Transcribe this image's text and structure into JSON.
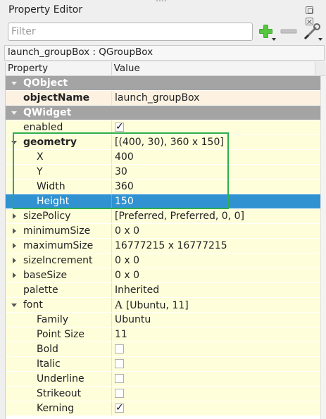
{
  "window": {
    "title": "Property Editor"
  },
  "toolbar": {
    "filter_placeholder": "Filter",
    "add_icon": "green-plus-icon",
    "remove_icon": "minus-icon",
    "config_icon": "wrench-icon"
  },
  "class_label": "launch_groupBox : QGroupBox",
  "columns": {
    "property": "Property",
    "value": "Value"
  },
  "rows": [
    {
      "prop": "QObject",
      "value": "",
      "kind": "group"
    },
    {
      "prop": "objectName",
      "value": "launch_groupBox",
      "kind": "cream",
      "bold": true
    },
    {
      "prop": "QWidget",
      "value": "",
      "kind": "group"
    },
    {
      "prop": "enabled",
      "value": "",
      "kind": "yellow",
      "check": true
    },
    {
      "prop": "geometry",
      "value": "[(400, 30), 360 x 150]",
      "kind": "yellow",
      "bold": true,
      "expand": "down"
    },
    {
      "prop": "X",
      "value": "400",
      "kind": "yellow",
      "depth": 1
    },
    {
      "prop": "Y",
      "value": "30",
      "kind": "yellow",
      "depth": 1
    },
    {
      "prop": "Width",
      "value": "360",
      "kind": "yellow",
      "depth": 1
    },
    {
      "prop": "Height",
      "value": "150",
      "kind": "selected",
      "depth": 1
    },
    {
      "prop": "sizePolicy",
      "value": "[Preferred, Preferred, 0, 0]",
      "kind": "yellow",
      "expand": "right"
    },
    {
      "prop": "minimumSize",
      "value": "0 x 0",
      "kind": "yellow",
      "expand": "right"
    },
    {
      "prop": "maximumSize",
      "value": "16777215 x 16777215",
      "kind": "yellow",
      "expand": "right"
    },
    {
      "prop": "sizeIncrement",
      "value": "0 x 0",
      "kind": "yellow",
      "expand": "right"
    },
    {
      "prop": "baseSize",
      "value": "0 x 0",
      "kind": "yellow",
      "expand": "right"
    },
    {
      "prop": "palette",
      "value": "Inherited",
      "kind": "yellow"
    },
    {
      "prop": "font",
      "value": "[Ubuntu, 11]",
      "kind": "yellow",
      "expand": "down",
      "font_icon": "A"
    },
    {
      "prop": "Family",
      "value": "Ubuntu",
      "kind": "yellow",
      "depth": 1
    },
    {
      "prop": "Point Size",
      "value": "11",
      "kind": "yellow",
      "depth": 1
    },
    {
      "prop": "Bold",
      "value": "",
      "kind": "yellow",
      "depth": 1,
      "check": false
    },
    {
      "prop": "Italic",
      "value": "",
      "kind": "yellow",
      "depth": 1,
      "check": false
    },
    {
      "prop": "Underline",
      "value": "",
      "kind": "yellow",
      "depth": 1,
      "check": false
    },
    {
      "prop": "Strikeout",
      "value": "",
      "kind": "yellow",
      "depth": 1,
      "check": false
    },
    {
      "prop": "Kerning",
      "value": "",
      "kind": "yellow",
      "depth": 1,
      "check": true
    }
  ],
  "colors": {
    "group_header": "#a4a4a4",
    "row_yellow": "#fefedb",
    "row_cream": "#fdf2e2",
    "selection": "#3092d1",
    "highlight_box": "#2fae4d"
  }
}
